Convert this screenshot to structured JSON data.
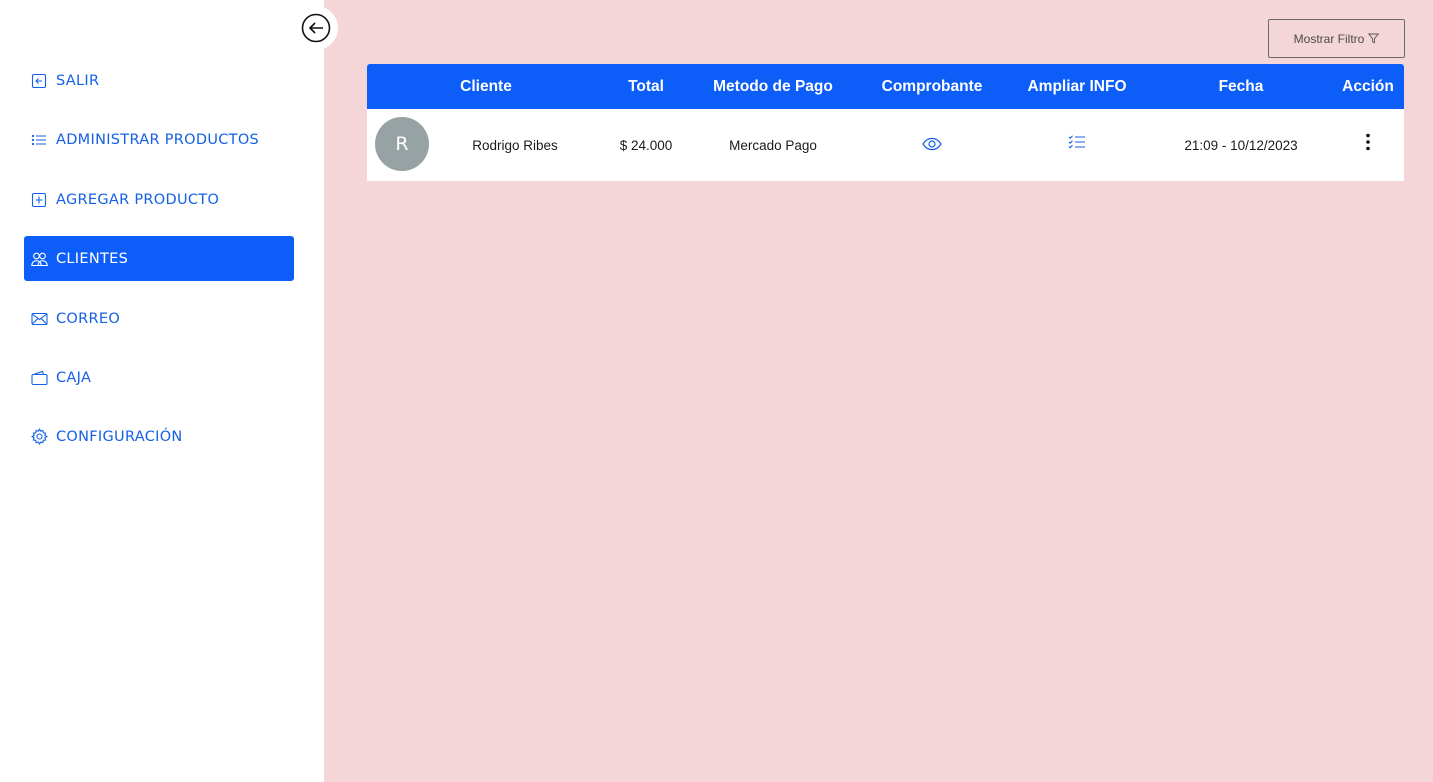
{
  "sidebar": {
    "collapse_icon": "arrow-left-circle-icon",
    "items": [
      {
        "label": "SALIR",
        "icon": "box-arrow-left-icon"
      },
      {
        "label": "ADMINISTRAR PRODUCTOS",
        "icon": "list-icon"
      },
      {
        "label": "AGREGAR PRODUCTO",
        "icon": "plus-square-icon"
      },
      {
        "label": "CLIENTES",
        "icon": "people-icon",
        "active": true
      },
      {
        "label": "CORREO",
        "icon": "envelope-icon"
      },
      {
        "label": "CAJA",
        "icon": "wallet-icon"
      },
      {
        "label": "CONFIGURACIÓN",
        "icon": "gear-icon"
      }
    ]
  },
  "toolbar": {
    "filter_label": "Mostrar Filtro",
    "filter_icon": "funnel-icon"
  },
  "table": {
    "headers": {
      "cliente": "Cliente",
      "total": "Total",
      "metodo": "Metodo de Pago",
      "comprobante": "Comprobante",
      "ampliar": "Ampliar INFO",
      "fecha": "Fecha",
      "accion": "Acción"
    },
    "rows": [
      {
        "avatar": "R",
        "cliente": "Rodrigo Ribes",
        "total": "$ 24.000",
        "metodo": "Mercado Pago",
        "comprobante_icon": "eye-icon",
        "ampliar_icon": "list-check-icon",
        "fecha": "21:09 - 10/12/2023",
        "accion_icon": "three-dots-vertical-icon"
      }
    ]
  },
  "colors": {
    "primary": "#0d5ef9",
    "link": "#1460e6",
    "background": "#f4d6d8",
    "avatar": "#97a2a4"
  }
}
